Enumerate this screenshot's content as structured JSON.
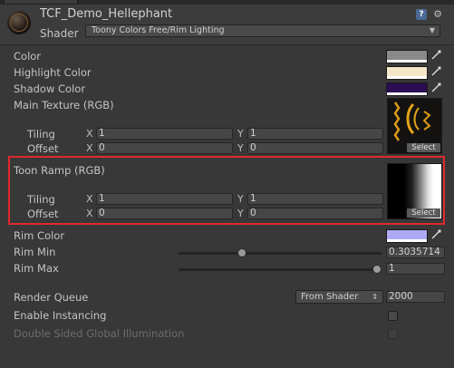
{
  "header": {
    "material_name": "TCF_Demo_Hellephant",
    "shader_label": "Shader",
    "shader_value": "Toony Colors Free/Rim Lighting",
    "help_icon_glyph": "?",
    "gear_icon_glyph": "⚙"
  },
  "properties": {
    "color": {
      "label": "Color",
      "swatch": "#8a8a8a"
    },
    "highlight_color": {
      "label": "Highlight Color",
      "swatch": "#f6e6c9"
    },
    "shadow_color": {
      "label": "Shadow Color",
      "swatch": "#2a0d52"
    },
    "main_texture": {
      "label": "Main Texture (RGB)",
      "tiling_label": "Tiling",
      "offset_label": "Offset",
      "x_label": "X",
      "y_label": "Y",
      "tiling_x": "1",
      "tiling_y": "1",
      "offset_x": "0",
      "offset_y": "0",
      "select_label": "Select"
    },
    "toon_ramp": {
      "label": "Toon Ramp (RGB)",
      "tiling_label": "Tiling",
      "offset_label": "Offset",
      "x_label": "X",
      "y_label": "Y",
      "tiling_x": "1",
      "tiling_y": "1",
      "offset_x": "0",
      "offset_y": "0",
      "select_label": "Select"
    },
    "rim_color": {
      "label": "Rim Color",
      "swatch": "#b0aaf6"
    },
    "rim_min": {
      "label": "Rim Min",
      "value": "0.3035714",
      "fraction": 0.3035714
    },
    "rim_max": {
      "label": "Rim Max",
      "value": "1",
      "fraction": 1.0
    },
    "render_queue": {
      "label": "Render Queue",
      "dropdown": "From Shader",
      "value": "2000"
    },
    "enable_instancing": {
      "label": "Enable Instancing",
      "checked": false
    },
    "double_sided_gi": {
      "label": "Double Sided Global Illumination",
      "checked": false
    }
  },
  "accent": {
    "highlight_box": "#e0292d"
  },
  "icons": {
    "picker": "eyedropper-icon",
    "dropdown_caret": "▼",
    "stepper_caret": "⇕"
  }
}
